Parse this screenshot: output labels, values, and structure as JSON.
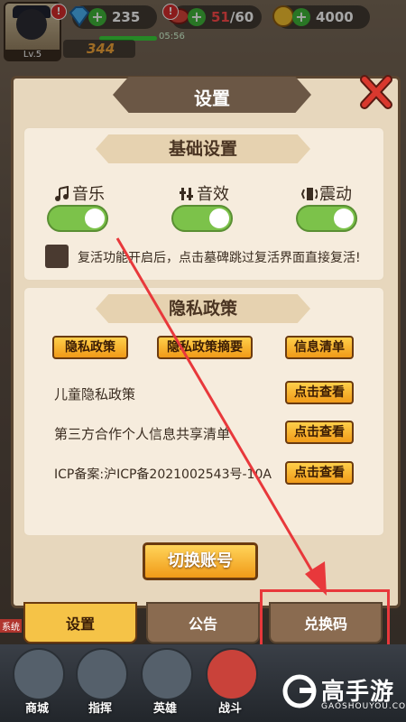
{
  "hud": {
    "level": "Lv.5",
    "gems": "235",
    "stamina": "51",
    "stamina_max": "/60",
    "gold": "4000",
    "timer": "05:56",
    "power": "344",
    "badge": "!"
  },
  "dialog": {
    "title": "设置",
    "basic_section": "基础设置",
    "music_label": "音乐",
    "sfx_label": "音效",
    "vibrate_label": "震动",
    "revive_text": "复活功能开启后，点击墓碑跳过复活界面直接复活!",
    "privacy_section": "隐私政策",
    "privacy_btn": "隐私政策",
    "privacy_summary_btn": "隐私政策摘要",
    "info_list_btn": "信息清单",
    "child_privacy": "儿童隐私政策",
    "third_party": "第三方合作个人信息共享清单",
    "icp": "ICP备案:沪ICP备2021002543号-10A",
    "view_btn": "点击查看",
    "switch_account": "切换账号"
  },
  "tabs": {
    "settings": "设置",
    "notice": "公告",
    "redeem": "兑换码"
  },
  "bottom_nav": {
    "shop": "商城",
    "command": "指挥",
    "heroes": "英雄",
    "battle": "战斗",
    "side_text": "系统"
  },
  "watermark": {
    "title": "高手游",
    "sub": "GAOSHOUYOU.COM"
  },
  "colors": {
    "accent": "#f5c347",
    "toggle_on": "#7cc24a",
    "highlight": "#e8383b"
  }
}
